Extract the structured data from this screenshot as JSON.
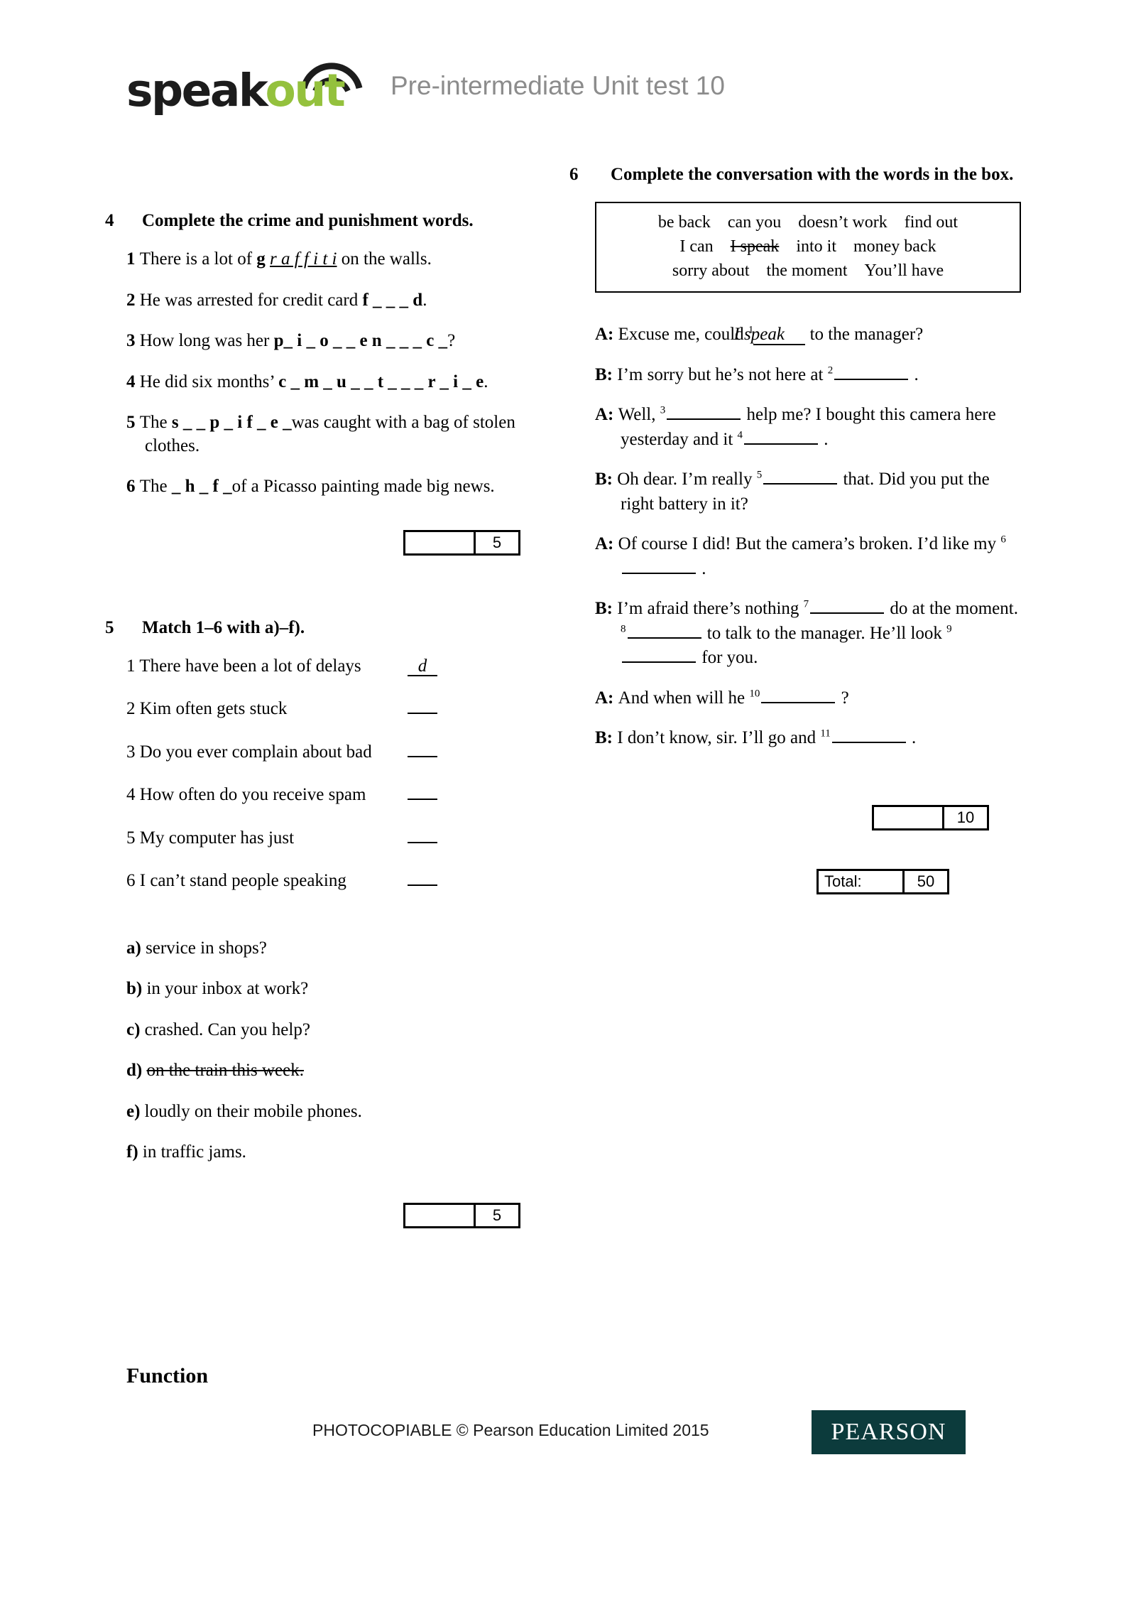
{
  "header": {
    "logo_speak": "speak",
    "logo_out": "out",
    "logo_icon": "wifi-arc-icon",
    "title": "Pre-intermediate Unit test 10"
  },
  "exercise4": {
    "number": "4",
    "title": "Complete the crime and punishment words.",
    "items": [
      {
        "n": "1",
        "pre": "There is a lot of ",
        "word_prefix": "g",
        "answer": "r a f f i t i",
        "post": "on the walls.",
        "filled": true
      },
      {
        "n": "2",
        "pre": "He was arrested for credit card ",
        "gap": "f _ _ _ d",
        "post": "."
      },
      {
        "n": "3",
        "pre": "How long was her ",
        "gap": "p_ i _ o _   _ e n _ _ _ c _",
        "post": "?"
      },
      {
        "n": "4",
        "pre": "He did six months’ ",
        "gap": "c _ m _ u _ _ t _   _ _ r _ i _ e",
        "post": "."
      },
      {
        "n": "5",
        "pre": "The ",
        "gap": "s _ _ p _ i f _ e _",
        "post": "was caught with a bag of stolen clothes."
      },
      {
        "n": "6",
        "pre": "The ",
        "gap": "_ h _ f _",
        "post": "of a Picasso painting made big news."
      }
    ],
    "score": {
      "label": "",
      "value": "5"
    }
  },
  "exercise5": {
    "number": "5",
    "title": "Match 1–6 with a)–f).",
    "stems": [
      {
        "n": "1",
        "text": "There have been a lot of delays",
        "answer": "d"
      },
      {
        "n": "2",
        "text": "Kim often gets stuck",
        "answer": ""
      },
      {
        "n": "3",
        "text": "Do you ever complain about bad",
        "answer": ""
      },
      {
        "n": "4",
        "text": "How often do you receive spam",
        "answer": ""
      },
      {
        "n": "5",
        "text": "My computer has just",
        "answer": ""
      },
      {
        "n": "6",
        "text": "I can’t stand people speaking",
        "answer": ""
      }
    ],
    "options": [
      {
        "label": "a)",
        "text": "service in shops?",
        "struck": false
      },
      {
        "label": "b)",
        "text": "in your inbox at work?",
        "struck": false
      },
      {
        "label": "c)",
        "text": "crashed. Can you help?",
        "struck": false
      },
      {
        "label": "d)",
        "text": "on the train this week.",
        "struck": true
      },
      {
        "label": "e)",
        "text": "loudly on their mobile phones.",
        "struck": false
      },
      {
        "label": "f)",
        "text": "in traffic jams.",
        "struck": false
      }
    ],
    "score": {
      "label": "",
      "value": "5"
    }
  },
  "exercise6": {
    "number": "6",
    "title": "Complete the conversation with the words in the box.",
    "wordbox": [
      [
        {
          "text": "be back",
          "struck": false
        },
        {
          "text": "can you",
          "struck": false
        },
        {
          "text": "doesn’t work",
          "struck": false
        },
        {
          "text": "find out",
          "struck": false
        }
      ],
      [
        {
          "text": "I can",
          "struck": false
        },
        {
          "text": "I speak",
          "struck": true
        },
        {
          "text": "into it",
          "struck": false
        },
        {
          "text": "money back",
          "struck": false
        }
      ],
      [
        {
          "text": "sorry about",
          "struck": false
        },
        {
          "text": "the moment",
          "struck": false
        },
        {
          "text": "You’ll have",
          "struck": false
        }
      ]
    ],
    "dialogue": [
      {
        "speaker": "A:",
        "parts": [
          {
            "t": "text",
            "v": "Excuse me, could "
          },
          {
            "t": "sup",
            "v": "1"
          },
          {
            "t": "answer",
            "v": "I speak"
          },
          {
            "t": "text",
            "v": " to the manager?"
          }
        ]
      },
      {
        "speaker": "B:",
        "parts": [
          {
            "t": "text",
            "v": "I’m sorry but he’s not here at "
          },
          {
            "t": "sup",
            "v": "2"
          },
          {
            "t": "blank",
            "v": ""
          },
          {
            "t": "text",
            "v": " ."
          }
        ]
      },
      {
        "speaker": "A:",
        "parts": [
          {
            "t": "text",
            "v": "Well, "
          },
          {
            "t": "sup",
            "v": "3"
          },
          {
            "t": "blank",
            "v": ""
          },
          {
            "t": "text",
            "v": " help me? I bought this camera here yesterday and it "
          },
          {
            "t": "sup",
            "v": "4"
          },
          {
            "t": "blank",
            "v": ""
          },
          {
            "t": "text",
            "v": " ."
          }
        ]
      },
      {
        "speaker": "B:",
        "parts": [
          {
            "t": "text",
            "v": "Oh dear. I’m really "
          },
          {
            "t": "sup",
            "v": "5"
          },
          {
            "t": "blank",
            "v": ""
          },
          {
            "t": "text",
            "v": " that. Did you put the right battery in it?"
          }
        ]
      },
      {
        "speaker": "A:",
        "parts": [
          {
            "t": "text",
            "v": "Of course I did! But the camera’s broken. I’d like my "
          },
          {
            "t": "sup",
            "v": "6"
          },
          {
            "t": "blank",
            "v": ""
          },
          {
            "t": "text",
            "v": " ."
          }
        ]
      },
      {
        "speaker": "B:",
        "parts": [
          {
            "t": "text",
            "v": "I’m afraid there’s nothing "
          },
          {
            "t": "sup",
            "v": "7"
          },
          {
            "t": "blank",
            "v": ""
          },
          {
            "t": "text",
            "v": " do at the moment. "
          },
          {
            "t": "sup",
            "v": "8"
          },
          {
            "t": "blank",
            "v": ""
          },
          {
            "t": "text",
            "v": " to talk to the manager. He’ll look "
          },
          {
            "t": "sup",
            "v": "9"
          },
          {
            "t": "blank",
            "v": ""
          },
          {
            "t": "text",
            "v": " for you."
          }
        ]
      },
      {
        "speaker": "A:",
        "parts": [
          {
            "t": "text",
            "v": "And when will he "
          },
          {
            "t": "sup",
            "v": "10"
          },
          {
            "t": "blank",
            "v": ""
          },
          {
            "t": "text",
            "v": " ?"
          }
        ]
      },
      {
        "speaker": "B:",
        "parts": [
          {
            "t": "text",
            "v": "I don’t know, sir. I’ll go and "
          },
          {
            "t": "sup",
            "v": "11"
          },
          {
            "t": "blank",
            "v": ""
          },
          {
            "t": "text",
            "v": " ."
          }
        ]
      }
    ],
    "score": {
      "label": "",
      "value": "10"
    }
  },
  "total": {
    "label": "Total:",
    "value": "50"
  },
  "function_heading": "Function",
  "footer": {
    "copyright": "PHOTOCOPIABLE © Pearson Education Limited 2015",
    "brand": "PEARSON",
    "brand_color": "#0c3b3c"
  }
}
